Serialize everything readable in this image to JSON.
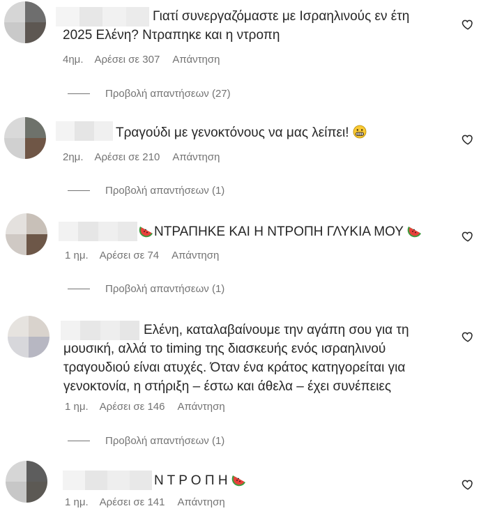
{
  "comments": [
    {
      "text_line1": "Γιατί συνεργαζόμαστε με Ισραηλινούς εν έτη",
      "text_line2": "2025 Ελένη? Ντραπηκε και η ντροπη",
      "time": "4ημ.",
      "likes": "Αρέσει σε 307",
      "reply": "Απάντηση",
      "view_replies": "Προβολή απαντήσεων (27)"
    },
    {
      "text_line1": "Τραγούδι με γενοκτόνους να μας λείπει!",
      "time": "2ημ.",
      "likes": "Αρέσει σε 210",
      "reply": "Απάντηση",
      "view_replies": "Προβολή απαντήσεων (1)",
      "emoji": "grimacing-face"
    },
    {
      "text_line1": "ΝΤΡΑΠΗΚΕ ΚΑΙ Η ΝΤΡΟΠΗ ΓΛΥΚΙΑ ΜΟΥ",
      "time": "1 ημ.",
      "likes": "Αρέσει σε 74",
      "reply": "Απάντηση",
      "view_replies": "Προβολή απαντήσεων (1)",
      "emoji": "watermelon"
    },
    {
      "text_line1": "Ελένη, καταλαβαίνουμε την αγάπη σου για τη",
      "text_line2": "μουσική, αλλά το timing της διασκευής ενός ισραηλινού",
      "text_line3": "τραγουδιού είναι ατυχές. Όταν ένα κράτος κατηγορείται για",
      "text_line4": "γενοκτονία, η στήριξη – έστω και άθελα – έχει συνέπειες",
      "time": "1 ημ.",
      "likes": "Αρέσει σε 146",
      "reply": "Απάντηση",
      "view_replies": "Προβολή απαντήσεων (1)"
    },
    {
      "text_line1": "Ν Τ Ρ Ο Π Η",
      "time": "1 ημ.",
      "likes": "Αρέσει σε 141",
      "reply": "Απάντηση",
      "emoji": "watermelon"
    }
  ],
  "icons": {
    "like": "heart-icon"
  },
  "colors": {
    "text": "#262626",
    "secondary": "#737373"
  }
}
